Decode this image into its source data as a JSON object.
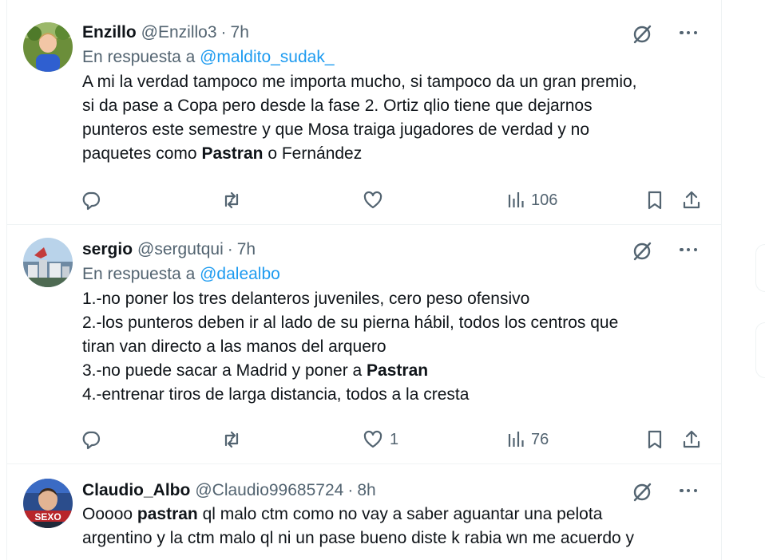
{
  "tweets": [
    {
      "name": "Enzillo",
      "handle": "@Enzillo3",
      "separator": "·",
      "time": "7h",
      "reply_prefix": "En respuesta a",
      "reply_to": "@maldito_sudak_",
      "lines": [
        [
          {
            "t": "A mi la verdad tampoco me importa mucho, si tampoco da un gran premio,"
          }
        ],
        [
          {
            "t": "si da pase a Copa pero desde la fase 2. Ortiz qlio tiene que dejarnos"
          }
        ],
        [
          {
            "t": "punteros este semestre y que Mosa traiga jugadores de verdad y no"
          }
        ],
        [
          {
            "t": "paquetes como "
          },
          {
            "t": "Pastran",
            "b": true
          },
          {
            "t": " o Fernández"
          }
        ]
      ],
      "replies": "",
      "retweets": "",
      "likes": "",
      "views": "106"
    },
    {
      "name": "sergio",
      "handle": "@sergutqui",
      "separator": "·",
      "time": "7h",
      "reply_prefix": "En respuesta a",
      "reply_to": "@dalealbo",
      "lines": [
        [
          {
            "t": "1.-no poner los tres delanteros juveniles, cero peso ofensivo"
          }
        ],
        [
          {
            "t": "2.-los punteros deben ir al lado de su pierna hábil, todos los centros que"
          }
        ],
        [
          {
            "t": "tiran van directo a las manos del arquero"
          }
        ],
        [
          {
            "t": "3.-no puede sacar a Madrid y poner a "
          },
          {
            "t": "Pastran",
            "b": true
          }
        ],
        [
          {
            "t": "4.-entrenar tiros de larga distancia, todos a la cresta"
          }
        ]
      ],
      "replies": "",
      "retweets": "",
      "likes": "1",
      "views": "76"
    },
    {
      "name": "Claudio_Albo",
      "handle": "@Claudio99685724",
      "separator": "·",
      "time": "8h",
      "reply_prefix": "",
      "reply_to": "",
      "lines": [
        [
          {
            "t": "Ooooo "
          },
          {
            "t": "pastran",
            "b": true
          },
          {
            "t": " ql malo ctm como no vay a saber aguantar una pelota"
          }
        ],
        [
          {
            "t": "argentino y la ctm malo ql ni un pase bueno diste k rabia wn me acuerdo y"
          }
        ]
      ],
      "avatar_text": "SEXO",
      "replies": "",
      "retweets": "",
      "likes": "",
      "views": ""
    }
  ],
  "icons": {
    "reply": "reply-icon",
    "retweet": "retweet-icon",
    "like": "heart-icon",
    "views": "views-chart-icon",
    "bookmark": "bookmark-icon",
    "share": "share-icon",
    "grok": "grok-icon",
    "more": "more-dots-icon"
  },
  "colors": {
    "text": "#0f1419",
    "secondary": "#536471",
    "link": "#1d9bf0",
    "border": "#eff3f4"
  }
}
